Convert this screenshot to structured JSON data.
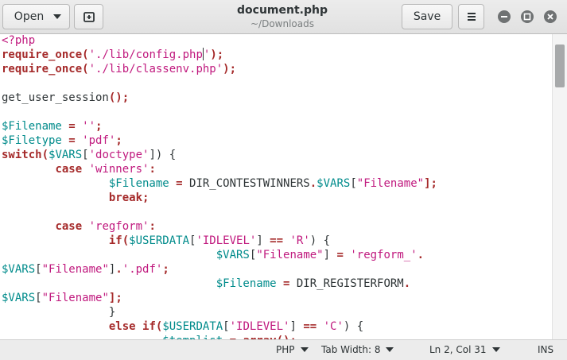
{
  "header": {
    "open_label": "Open",
    "title": "document.php",
    "subtitle": "~/Downloads",
    "save_label": "Save"
  },
  "colors": {
    "keyword": "#a52a2a",
    "string": "#c0197e",
    "variable": "#008b8b",
    "text": "#2e3436"
  },
  "code_lines": [
    [
      {
        "t": "<?php",
        "c": "str"
      }
    ],
    [
      {
        "t": "require_once",
        "c": "kw"
      },
      {
        "t": "(",
        "c": "kw"
      },
      {
        "t": "'./lib/config.php",
        "c": "str"
      },
      {
        "t": "|",
        "c": "cursor"
      },
      {
        "t": "'",
        "c": "str"
      },
      {
        "t": ");",
        "c": "kw"
      }
    ],
    [
      {
        "t": "require_once",
        "c": "kw"
      },
      {
        "t": "(",
        "c": "kw"
      },
      {
        "t": "'./lib/classenv.php'",
        "c": "str"
      },
      {
        "t": ");",
        "c": "kw"
      }
    ],
    [],
    [
      {
        "t": "get_user_session",
        "c": "txt"
      },
      {
        "t": "();",
        "c": "kw"
      }
    ],
    [],
    [
      {
        "t": "$Filename",
        "c": "var"
      },
      {
        "t": " = ",
        "c": "kw"
      },
      {
        "t": "''",
        "c": "str"
      },
      {
        "t": ";",
        "c": "kw"
      }
    ],
    [
      {
        "t": "$Filetype",
        "c": "var"
      },
      {
        "t": " = ",
        "c": "kw"
      },
      {
        "t": "'pdf'",
        "c": "str"
      },
      {
        "t": ";",
        "c": "kw"
      }
    ],
    [
      {
        "t": "switch",
        "c": "kw"
      },
      {
        "t": "(",
        "c": "kw"
      },
      {
        "t": "$VARS",
        "c": "var"
      },
      {
        "t": "[",
        "c": "txt"
      },
      {
        "t": "'doctype'",
        "c": "str"
      },
      {
        "t": "]) {",
        "c": "txt"
      }
    ],
    [
      {
        "t": "        ",
        "c": "txt"
      },
      {
        "t": "case",
        "c": "kw"
      },
      {
        "t": " ",
        "c": "txt"
      },
      {
        "t": "'winners'",
        "c": "str"
      },
      {
        "t": ":",
        "c": "kw"
      }
    ],
    [
      {
        "t": "                ",
        "c": "txt"
      },
      {
        "t": "$Filename",
        "c": "var"
      },
      {
        "t": " = ",
        "c": "kw"
      },
      {
        "t": "DIR_CONTESTWINNERS",
        "c": "txt"
      },
      {
        "t": ".",
        "c": "kw"
      },
      {
        "t": "$VARS",
        "c": "var"
      },
      {
        "t": "[",
        "c": "txt"
      },
      {
        "t": "\"Filename\"",
        "c": "str"
      },
      {
        "t": "];",
        "c": "kw"
      }
    ],
    [
      {
        "t": "                ",
        "c": "txt"
      },
      {
        "t": "break",
        "c": "kw"
      },
      {
        "t": ";",
        "c": "kw"
      }
    ],
    [],
    [
      {
        "t": "        ",
        "c": "txt"
      },
      {
        "t": "case",
        "c": "kw"
      },
      {
        "t": " ",
        "c": "txt"
      },
      {
        "t": "'regform'",
        "c": "str"
      },
      {
        "t": ":",
        "c": "kw"
      }
    ],
    [
      {
        "t": "                ",
        "c": "txt"
      },
      {
        "t": "if",
        "c": "kw"
      },
      {
        "t": "(",
        "c": "kw"
      },
      {
        "t": "$USERDATA",
        "c": "var"
      },
      {
        "t": "[",
        "c": "txt"
      },
      {
        "t": "'IDLEVEL'",
        "c": "str"
      },
      {
        "t": "] ",
        "c": "txt"
      },
      {
        "t": "==",
        "c": "kw"
      },
      {
        "t": " ",
        "c": "txt"
      },
      {
        "t": "'R'",
        "c": "str"
      },
      {
        "t": ") {",
        "c": "txt"
      }
    ],
    [
      {
        "t": "                                ",
        "c": "txt"
      },
      {
        "t": "$VARS",
        "c": "var"
      },
      {
        "t": "[",
        "c": "txt"
      },
      {
        "t": "\"Filename\"",
        "c": "str"
      },
      {
        "t": "] ",
        "c": "txt"
      },
      {
        "t": "=",
        "c": "kw"
      },
      {
        "t": " ",
        "c": "txt"
      },
      {
        "t": "'regform_'",
        "c": "str"
      },
      {
        "t": ".",
        "c": "kw"
      }
    ],
    [
      {
        "t": "$VARS",
        "c": "var"
      },
      {
        "t": "[",
        "c": "txt"
      },
      {
        "t": "\"Filename\"",
        "c": "str"
      },
      {
        "t": "]",
        "c": "txt"
      },
      {
        "t": ".",
        "c": "kw"
      },
      {
        "t": "'.pdf'",
        "c": "str"
      },
      {
        "t": ";",
        "c": "kw"
      }
    ],
    [
      {
        "t": "                                ",
        "c": "txt"
      },
      {
        "t": "$Filename",
        "c": "var"
      },
      {
        "t": " = ",
        "c": "kw"
      },
      {
        "t": "DIR_REGISTERFORM",
        "c": "txt"
      },
      {
        "t": ".",
        "c": "kw"
      }
    ],
    [
      {
        "t": "$VARS",
        "c": "var"
      },
      {
        "t": "[",
        "c": "txt"
      },
      {
        "t": "\"Filename\"",
        "c": "str"
      },
      {
        "t": "];",
        "c": "kw"
      }
    ],
    [
      {
        "t": "                }",
        "c": "txt"
      }
    ],
    [
      {
        "t": "                ",
        "c": "txt"
      },
      {
        "t": "else",
        "c": "kw"
      },
      {
        "t": " ",
        "c": "txt"
      },
      {
        "t": "if",
        "c": "kw"
      },
      {
        "t": "(",
        "c": "kw"
      },
      {
        "t": "$USERDATA",
        "c": "var"
      },
      {
        "t": "[",
        "c": "txt"
      },
      {
        "t": "'IDLEVEL'",
        "c": "str"
      },
      {
        "t": "] ",
        "c": "txt"
      },
      {
        "t": "==",
        "c": "kw"
      },
      {
        "t": " ",
        "c": "txt"
      },
      {
        "t": "'C'",
        "c": "str"
      },
      {
        "t": ") {",
        "c": "txt"
      }
    ],
    [
      {
        "t": "                        ",
        "c": "txt"
      },
      {
        "t": "$templist",
        "c": "var"
      },
      {
        "t": " = ",
        "c": "kw"
      },
      {
        "t": "array",
        "c": "kw"
      },
      {
        "t": "();",
        "c": "kw"
      }
    ]
  ],
  "statusbar": {
    "language": "PHP",
    "tab_width": "Tab Width: 8",
    "position": "Ln 2, Col 31",
    "mode": "INS"
  }
}
